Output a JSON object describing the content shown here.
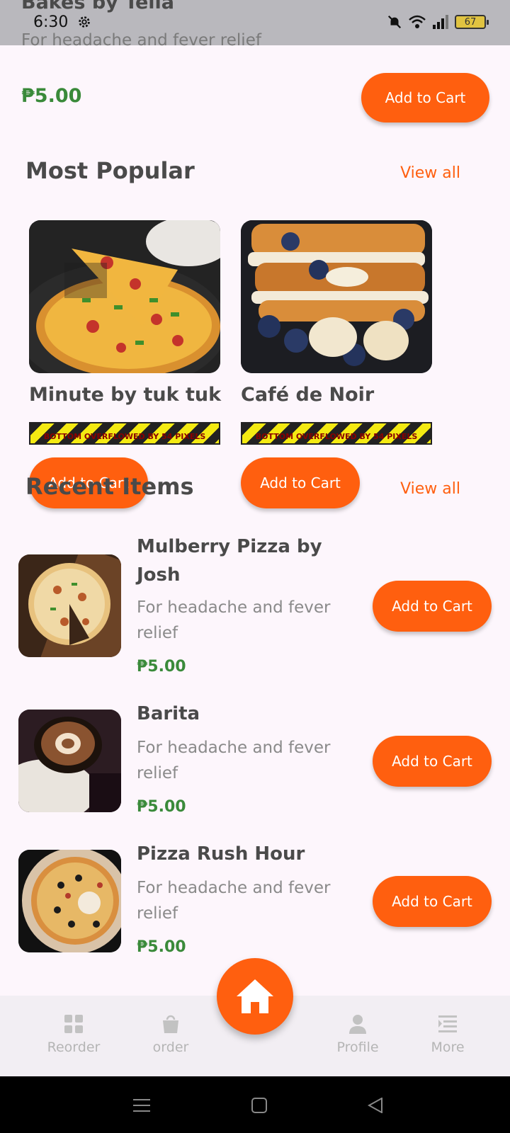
{
  "status_bar": {
    "time": "6:30",
    "battery": "67",
    "behind_title": "Bakes by Tella",
    "behind_desc": "For headache and fever relief"
  },
  "top_item": {
    "price": "₱5.00",
    "add_label": "Add to Cart"
  },
  "most_popular": {
    "title": "Most Popular",
    "view_all": "View all",
    "items": [
      {
        "name": "Minute by tuk tuk",
        "overflow": "BOTTOM OVERFLOWED BY 54 PIXELS",
        "add_label": "Add to Cart"
      },
      {
        "name": "Café de Noir",
        "overflow": "BOTTOM OVERFLOWED BY 54 PIXELS",
        "add_label": "Add to Cart"
      }
    ]
  },
  "recent_items": {
    "title": "Recent Items",
    "view_all": "View all",
    "items": [
      {
        "name": "Mulberry Pizza by Josh",
        "desc": "For headache and fever relief",
        "price": "₱5.00",
        "add_label": "Add to Cart"
      },
      {
        "name": "Barita",
        "desc": "For headache and fever relief",
        "price": "₱5.00",
        "add_label": "Add to Cart"
      },
      {
        "name": "Pizza Rush Hour",
        "desc": "For headache and fever relief",
        "price": "₱5.00",
        "add_label": "Add to Cart"
      }
    ]
  },
  "bottom_nav": {
    "items": [
      {
        "label": "Reorder",
        "icon": "grid-icon"
      },
      {
        "label": "order",
        "icon": "shopping-bag-icon"
      },
      {
        "label": "Profile",
        "icon": "person-icon"
      },
      {
        "label": "More",
        "icon": "menu-lines-icon"
      }
    ],
    "home_icon": "home-icon"
  },
  "colors": {
    "accent": "#ff5f0f",
    "price": "#3a8a3a",
    "background": "#fdf6fc"
  }
}
